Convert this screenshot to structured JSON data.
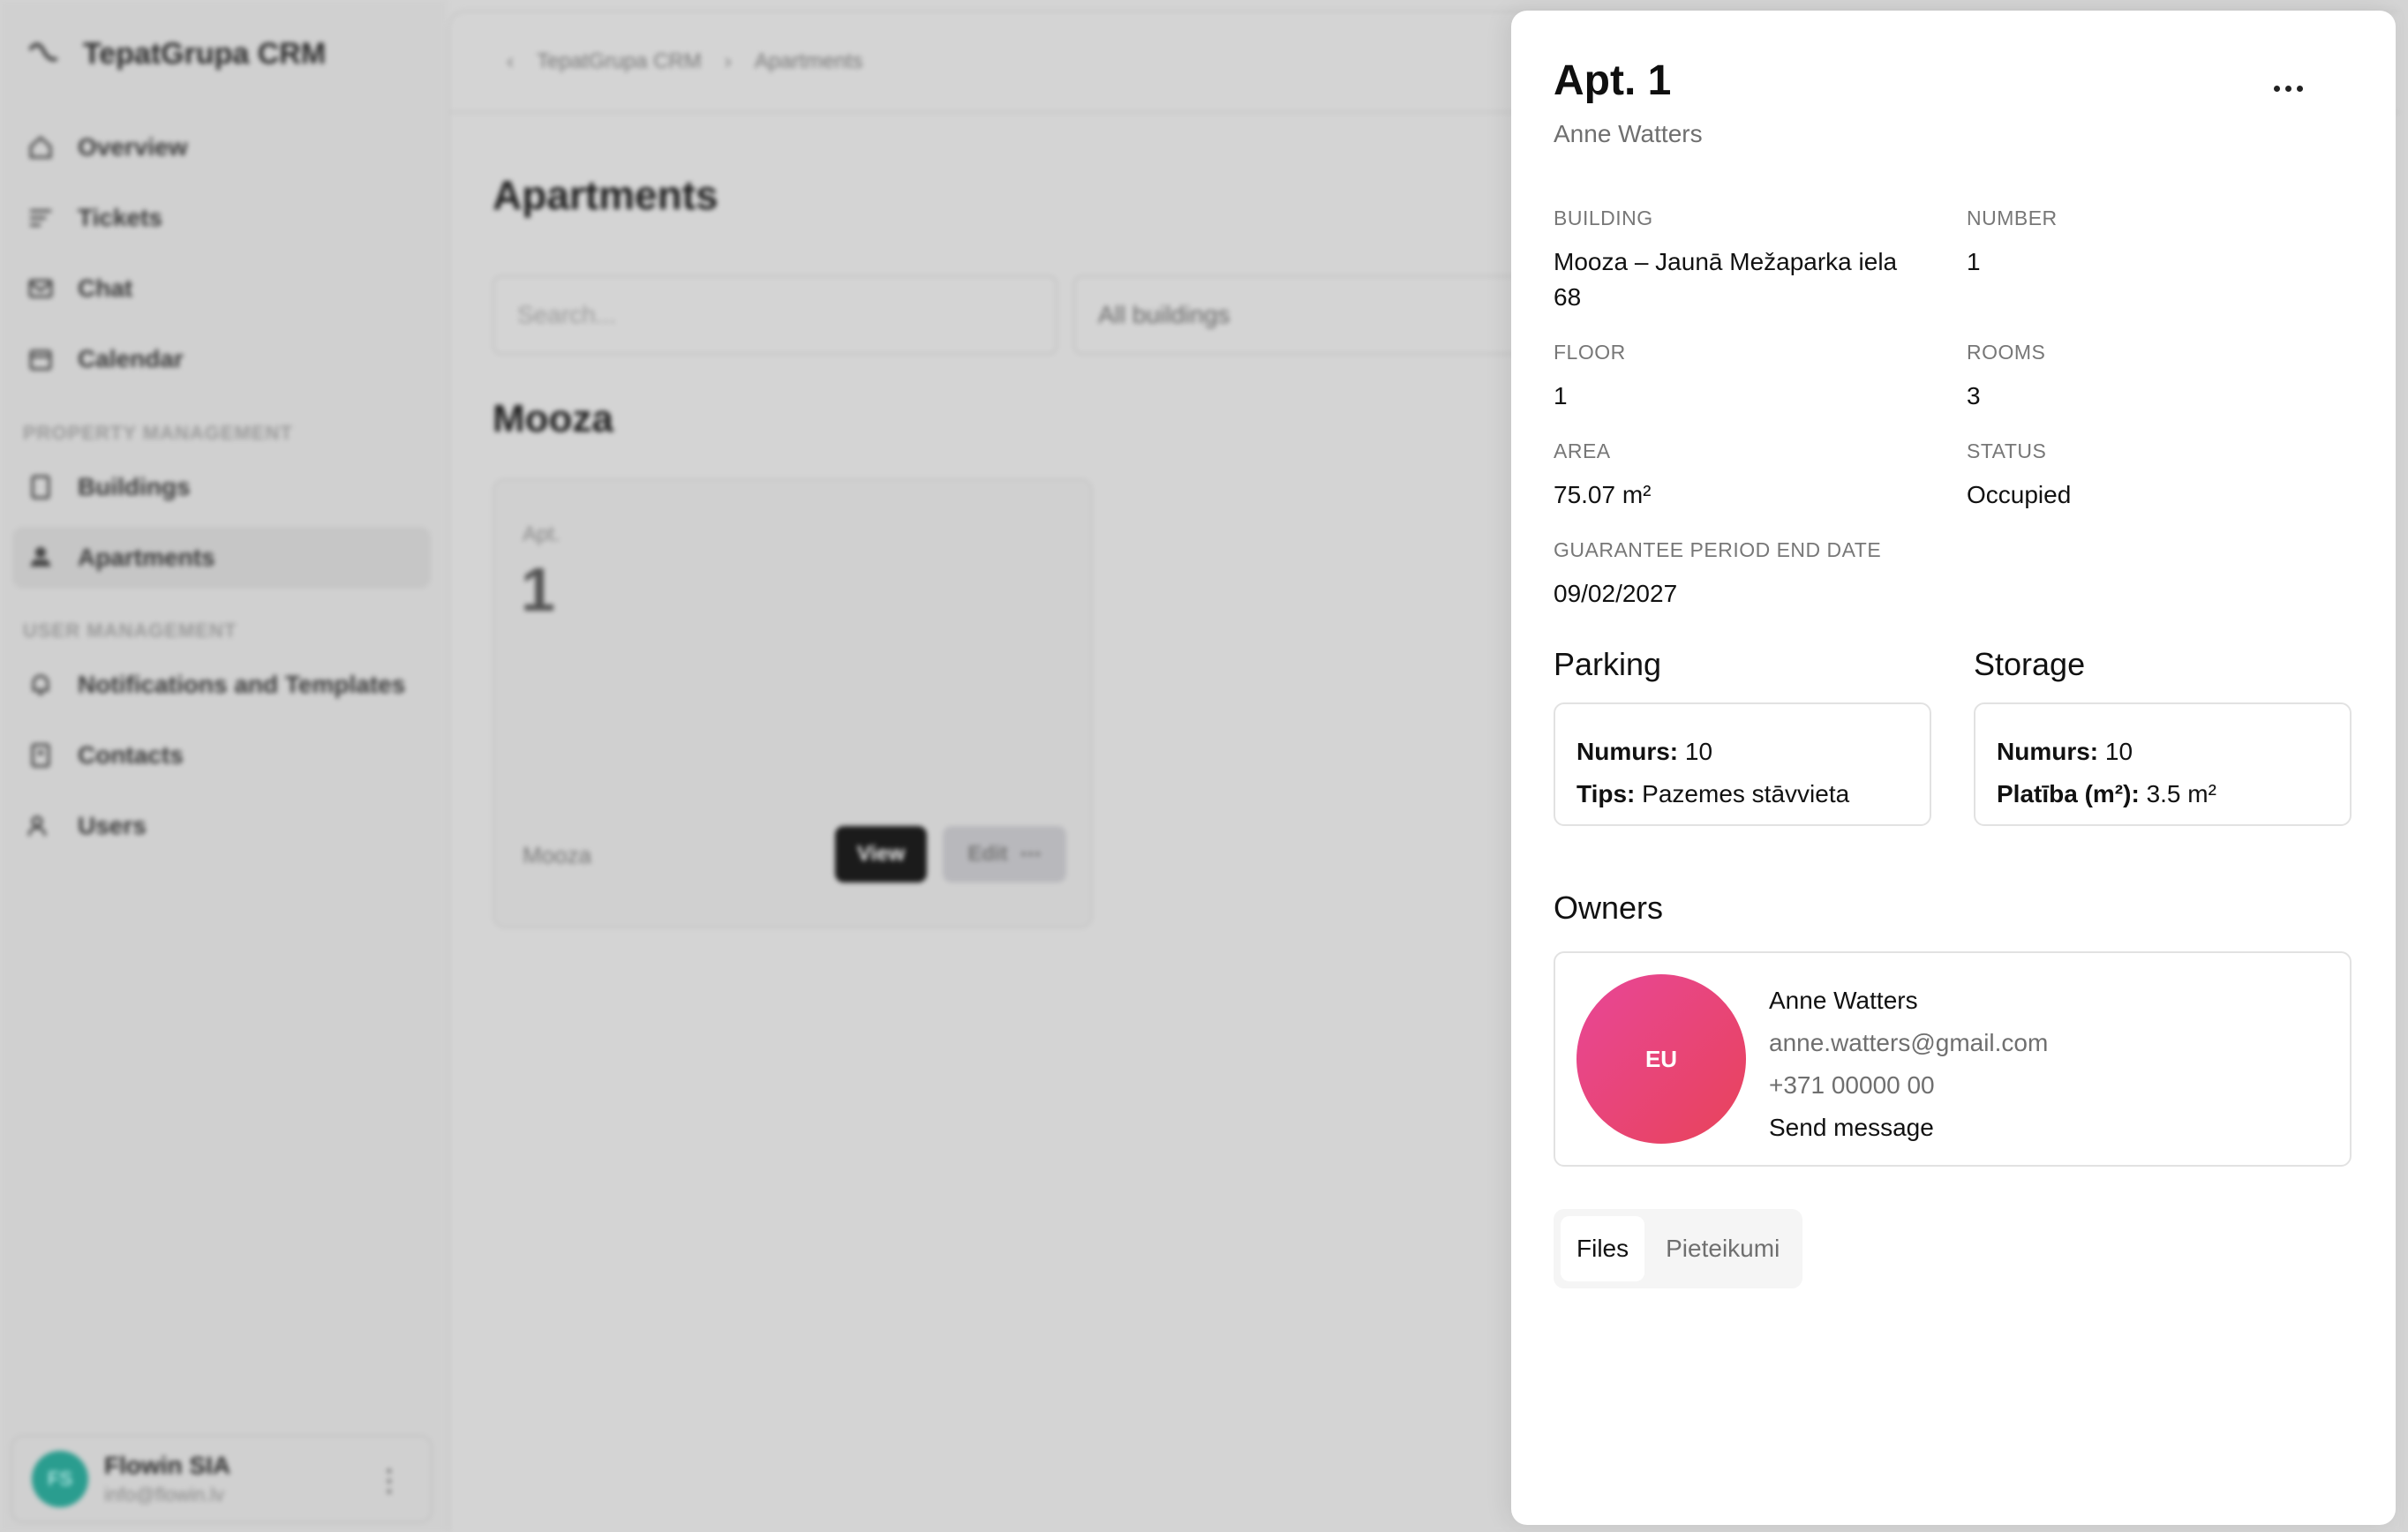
{
  "app": {
    "brand": "TepatGrupa CRM",
    "nav": {
      "overview": "Overview",
      "tickets": "Tickets",
      "chat": "Chat",
      "calendar": "Calendar",
      "section_property": "PROPERTY MANAGEMENT",
      "buildings": "Buildings",
      "apartments": "Apartments",
      "section_user": "USER MANAGEMENT",
      "notifications": "Notifications and Templates",
      "contacts": "Contacts",
      "users": "Users"
    },
    "user": {
      "initials": "FS",
      "name": "Flowin SIA",
      "email": "info@flowin.lv"
    },
    "breadcrumb": {
      "root": "TepatGrupa CRM",
      "current": "Apartments"
    },
    "page_title": "Apartments",
    "search_placeholder": "Search...",
    "filter_value": "All buildings",
    "group_title": "Mooza",
    "card": {
      "label": "Apt.",
      "number": "1",
      "building": "Mooza",
      "view": "View",
      "edit": "Edit"
    }
  },
  "drawer": {
    "title": "Apt. 1",
    "subtitle": "Anne Watters",
    "fields": {
      "building_label": "BUILDING",
      "building_value": "Mooza – Jaunā Mežaparka iela 68",
      "number_label": "NUMBER",
      "number_value": "1",
      "floor_label": "FLOOR",
      "floor_value": "1",
      "rooms_label": "ROOMS",
      "rooms_value": "3",
      "area_label": "AREA",
      "area_value": "75.07 m²",
      "status_label": "STATUS",
      "status_value": "Occupied",
      "guarantee_label": "GUARANTEE PERIOD END DATE",
      "guarantee_value": "09/02/2027"
    },
    "parking": {
      "title": "Parking",
      "numurs_label": "Numurs:",
      "numurs_value": "10",
      "tips_label": "Tips:",
      "tips_value": "Pazemes stāvvieta"
    },
    "storage": {
      "title": "Storage",
      "numurs_label": "Numurs:",
      "numurs_value": "10",
      "platiba_label": "Platība (m²):",
      "platiba_value": "3.5 m²"
    },
    "owners": {
      "title": "Owners",
      "initials": "EU",
      "name": "Anne Watters",
      "email": "anne.watters@gmail.com",
      "phone": "+371 00000 00",
      "send_message": "Send message"
    },
    "tabs": {
      "files": "Files",
      "pieteikumi": "Pieteikumi"
    }
  },
  "colors": {
    "owner_avatar_start": "#e84797",
    "owner_avatar_end": "#e8435a",
    "user_avatar": "#2a9d8f"
  }
}
